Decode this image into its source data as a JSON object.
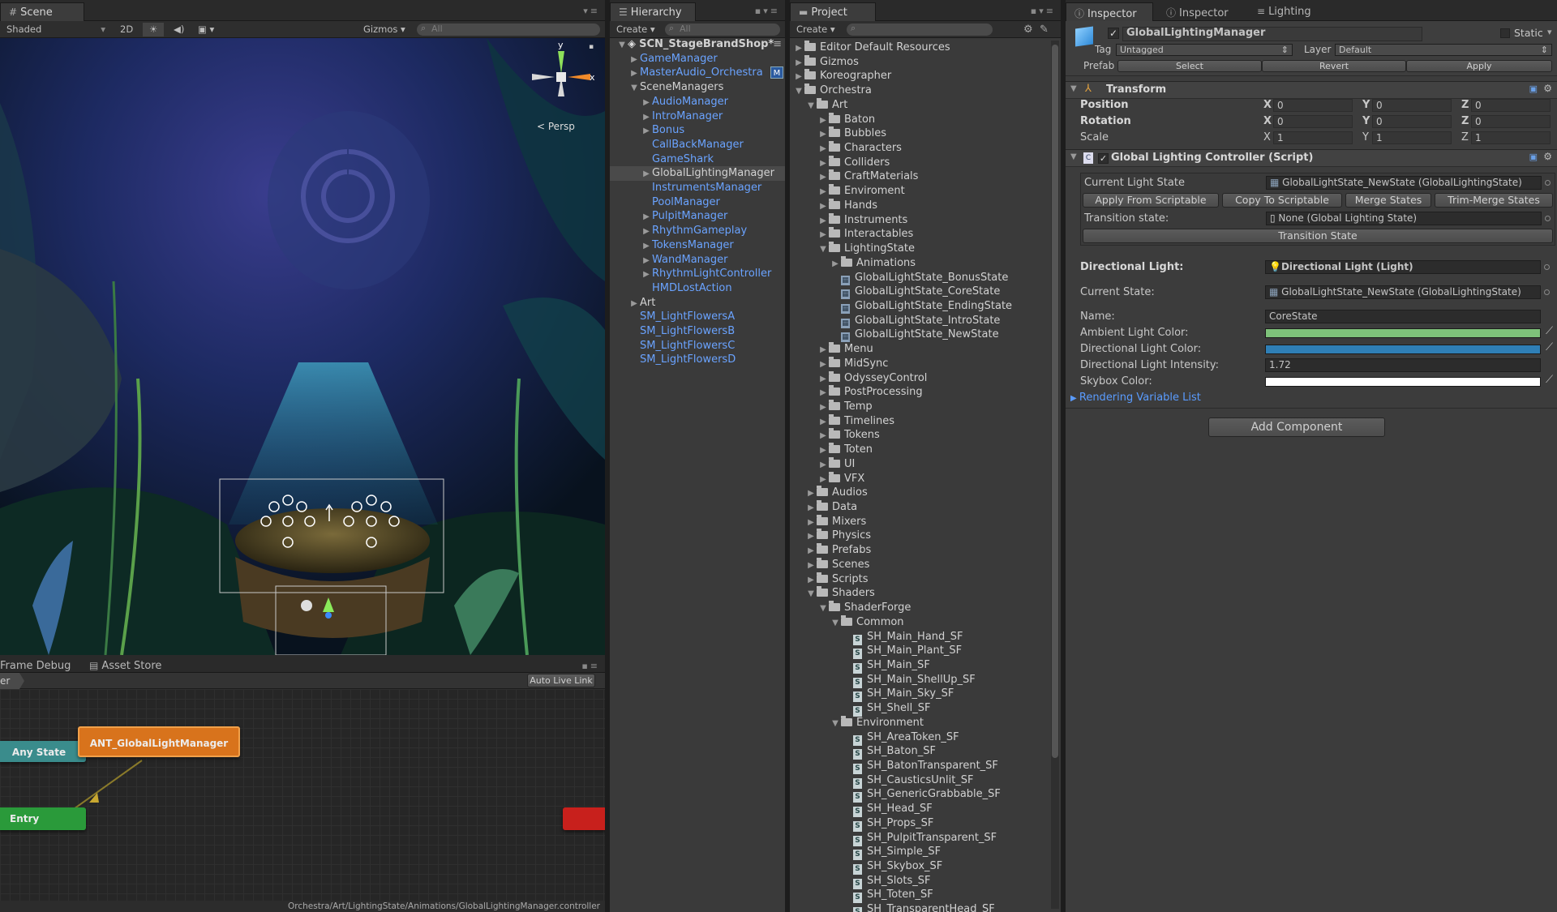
{
  "scene": {
    "tab": "Scene",
    "shading": "Shaded",
    "mode2d": "2D",
    "gizmos": "Gizmos",
    "search": "All",
    "persp": "Persp",
    "axis_x": "x",
    "axis_y": "y"
  },
  "animator": {
    "tab_frame": "Frame Debug",
    "tab_store": "Asset Store",
    "breadcrumb": "er",
    "auto_live": "Auto Live Link",
    "node_main": "ANT_GlobalLightManager",
    "node_any": "Any State",
    "node_entry": "Entry",
    "path": "Orchestra/Art/LightingState/Animations/GlobalLightingManager.controller"
  },
  "hierarchy": {
    "tab": "Hierarchy",
    "create": "Create",
    "search": "All",
    "items": [
      {
        "label": "SCN_StageBrandShop*",
        "depth": 0,
        "arrow": "▼",
        "style": "scene"
      },
      {
        "label": "GameManager",
        "depth": 1,
        "arrow": "▶",
        "style": "blue"
      },
      {
        "label": "MasterAudio_Orchestra",
        "depth": 1,
        "arrow": "▶",
        "style": "blue",
        "badge": "M"
      },
      {
        "label": "SceneManagers",
        "depth": 1,
        "arrow": "▼",
        "style": "wht"
      },
      {
        "label": "AudioManager",
        "depth": 2,
        "arrow": "▶",
        "style": "blue"
      },
      {
        "label": "IntroManager",
        "depth": 2,
        "arrow": "▶",
        "style": "blue"
      },
      {
        "label": "Bonus",
        "depth": 2,
        "arrow": "▶",
        "style": "blue"
      },
      {
        "label": "CallBackManager",
        "depth": 2,
        "arrow": "",
        "style": "blue"
      },
      {
        "label": "GameShark",
        "depth": 2,
        "arrow": "",
        "style": "blue"
      },
      {
        "label": "GlobalLightingManager",
        "depth": 2,
        "arrow": "▶",
        "style": "wht",
        "selected": true
      },
      {
        "label": "InstrumentsManager",
        "depth": 2,
        "arrow": "",
        "style": "blue"
      },
      {
        "label": "PoolManager",
        "depth": 2,
        "arrow": "",
        "style": "blue"
      },
      {
        "label": "PulpitManager",
        "depth": 2,
        "arrow": "▶",
        "style": "blue"
      },
      {
        "label": "RhythmGameplay",
        "depth": 2,
        "arrow": "▶",
        "style": "blue"
      },
      {
        "label": "TokensManager",
        "depth": 2,
        "arrow": "▶",
        "style": "blue"
      },
      {
        "label": "WandManager",
        "depth": 2,
        "arrow": "▶",
        "style": "blue"
      },
      {
        "label": "RhythmLightController",
        "depth": 2,
        "arrow": "▶",
        "style": "blue"
      },
      {
        "label": "HMDLostAction",
        "depth": 2,
        "arrow": "",
        "style": "blue"
      },
      {
        "label": "Art",
        "depth": 1,
        "arrow": "▶",
        "style": "wht"
      },
      {
        "label": "SM_LightFlowersA",
        "depth": 1,
        "arrow": "",
        "style": "blue"
      },
      {
        "label": "SM_LightFlowersB",
        "depth": 1,
        "arrow": "",
        "style": "blue"
      },
      {
        "label": "SM_LightFlowersC",
        "depth": 1,
        "arrow": "",
        "style": "blue"
      },
      {
        "label": "SM_LightFlowersD",
        "depth": 1,
        "arrow": "",
        "style": "blue"
      }
    ]
  },
  "project": {
    "tab": "Project",
    "create": "Create",
    "items": [
      {
        "label": "Editor Default Resources",
        "depth": 0,
        "arrow": "▶",
        "kind": "folder"
      },
      {
        "label": "Gizmos",
        "depth": 0,
        "arrow": "▶",
        "kind": "folder"
      },
      {
        "label": "Koreographer",
        "depth": 0,
        "arrow": "▶",
        "kind": "folder"
      },
      {
        "label": "Orchestra",
        "depth": 0,
        "arrow": "▼",
        "kind": "folder"
      },
      {
        "label": "Art",
        "depth": 1,
        "arrow": "▼",
        "kind": "folder"
      },
      {
        "label": "Baton",
        "depth": 2,
        "arrow": "▶",
        "kind": "folder"
      },
      {
        "label": "Bubbles",
        "depth": 2,
        "arrow": "▶",
        "kind": "folder"
      },
      {
        "label": "Characters",
        "depth": 2,
        "arrow": "▶",
        "kind": "folder"
      },
      {
        "label": "Colliders",
        "depth": 2,
        "arrow": "▶",
        "kind": "folder"
      },
      {
        "label": "CraftMaterials",
        "depth": 2,
        "arrow": "▶",
        "kind": "folder"
      },
      {
        "label": "Enviroment",
        "depth": 2,
        "arrow": "▶",
        "kind": "folder"
      },
      {
        "label": "Hands",
        "depth": 2,
        "arrow": "▶",
        "kind": "folder"
      },
      {
        "label": "Instruments",
        "depth": 2,
        "arrow": "▶",
        "kind": "folder"
      },
      {
        "label": "Interactables",
        "depth": 2,
        "arrow": "▶",
        "kind": "folder"
      },
      {
        "label": "LightingState",
        "depth": 2,
        "arrow": "▼",
        "kind": "folder"
      },
      {
        "label": "Animations",
        "depth": 3,
        "arrow": "▶",
        "kind": "folder"
      },
      {
        "label": "GlobalLightState_BonusState",
        "depth": 3,
        "arrow": "",
        "kind": "asset"
      },
      {
        "label": "GlobalLightState_CoreState",
        "depth": 3,
        "arrow": "",
        "kind": "asset"
      },
      {
        "label": "GlobalLightState_EndingState",
        "depth": 3,
        "arrow": "",
        "kind": "asset"
      },
      {
        "label": "GlobalLightState_IntroState",
        "depth": 3,
        "arrow": "",
        "kind": "asset"
      },
      {
        "label": "GlobalLightState_NewState",
        "depth": 3,
        "arrow": "",
        "kind": "asset"
      },
      {
        "label": "Menu",
        "depth": 2,
        "arrow": "▶",
        "kind": "folder"
      },
      {
        "label": "MidSync",
        "depth": 2,
        "arrow": "▶",
        "kind": "folder"
      },
      {
        "label": "OdysseyControl",
        "depth": 2,
        "arrow": "▶",
        "kind": "folder"
      },
      {
        "label": "PostProcessing",
        "depth": 2,
        "arrow": "▶",
        "kind": "folder"
      },
      {
        "label": "Temp",
        "depth": 2,
        "arrow": "▶",
        "kind": "folder"
      },
      {
        "label": "Timelines",
        "depth": 2,
        "arrow": "▶",
        "kind": "folder"
      },
      {
        "label": "Tokens",
        "depth": 2,
        "arrow": "▶",
        "kind": "folder"
      },
      {
        "label": "Toten",
        "depth": 2,
        "arrow": "▶",
        "kind": "folder"
      },
      {
        "label": "UI",
        "depth": 2,
        "arrow": "▶",
        "kind": "folder"
      },
      {
        "label": "VFX",
        "depth": 2,
        "arrow": "▶",
        "kind": "folder"
      },
      {
        "label": "Audios",
        "depth": 1,
        "arrow": "▶",
        "kind": "folder"
      },
      {
        "label": "Data",
        "depth": 1,
        "arrow": "▶",
        "kind": "folder"
      },
      {
        "label": "Mixers",
        "depth": 1,
        "arrow": "▶",
        "kind": "folder"
      },
      {
        "label": "Physics",
        "depth": 1,
        "arrow": "▶",
        "kind": "folder"
      },
      {
        "label": "Prefabs",
        "depth": 1,
        "arrow": "▶",
        "kind": "folder"
      },
      {
        "label": "Scenes",
        "depth": 1,
        "arrow": "▶",
        "kind": "folder"
      },
      {
        "label": "Scripts",
        "depth": 1,
        "arrow": "▶",
        "kind": "folder"
      },
      {
        "label": "Shaders",
        "depth": 1,
        "arrow": "▼",
        "kind": "folder"
      },
      {
        "label": "ShaderForge",
        "depth": 2,
        "arrow": "▼",
        "kind": "folder"
      },
      {
        "label": "Common",
        "depth": 3,
        "arrow": "▼",
        "kind": "folder"
      },
      {
        "label": "SH_Main_Hand_SF",
        "depth": 4,
        "arrow": "",
        "kind": "shader"
      },
      {
        "label": "SH_Main_Plant_SF",
        "depth": 4,
        "arrow": "",
        "kind": "shader"
      },
      {
        "label": "SH_Main_SF",
        "depth": 4,
        "arrow": "",
        "kind": "shader"
      },
      {
        "label": "SH_Main_ShellUp_SF",
        "depth": 4,
        "arrow": "",
        "kind": "shader"
      },
      {
        "label": "SH_Main_Sky_SF",
        "depth": 4,
        "arrow": "",
        "kind": "shader"
      },
      {
        "label": "SH_Shell_SF",
        "depth": 4,
        "arrow": "",
        "kind": "shader"
      },
      {
        "label": "Environment",
        "depth": 3,
        "arrow": "▼",
        "kind": "folder"
      },
      {
        "label": "SH_AreaToken_SF",
        "depth": 4,
        "arrow": "",
        "kind": "shader"
      },
      {
        "label": "SH_Baton_SF",
        "depth": 4,
        "arrow": "",
        "kind": "shader"
      },
      {
        "label": "SH_BatonTransparent_SF",
        "depth": 4,
        "arrow": "",
        "kind": "shader"
      },
      {
        "label": "SH_CausticsUnlit_SF",
        "depth": 4,
        "arrow": "",
        "kind": "shader"
      },
      {
        "label": "SH_GenericGrabbable_SF",
        "depth": 4,
        "arrow": "",
        "kind": "shader"
      },
      {
        "label": "SH_Head_SF",
        "depth": 4,
        "arrow": "",
        "kind": "shader"
      },
      {
        "label": "SH_Props_SF",
        "depth": 4,
        "arrow": "",
        "kind": "shader"
      },
      {
        "label": "SH_PulpitTransparent_SF",
        "depth": 4,
        "arrow": "",
        "kind": "shader"
      },
      {
        "label": "SH_Simple_SF",
        "depth": 4,
        "arrow": "",
        "kind": "shader"
      },
      {
        "label": "SH_Skybox_SF",
        "depth": 4,
        "arrow": "",
        "kind": "shader"
      },
      {
        "label": "SH_Slots_SF",
        "depth": 4,
        "arrow": "",
        "kind": "shader"
      },
      {
        "label": "SH_Toten_SF",
        "depth": 4,
        "arrow": "",
        "kind": "shader"
      },
      {
        "label": "SH_TransparentHead_SF",
        "depth": 4,
        "arrow": "",
        "kind": "shader"
      }
    ]
  },
  "inspector": {
    "tabs": [
      "Inspector",
      "Inspector",
      "Lighting"
    ],
    "object_name": "GlobalLightingManager",
    "static_label": "Static",
    "tag_label": "Tag",
    "tag_value": "Untagged",
    "layer_label": "Layer",
    "layer_value": "Default",
    "prefab_label": "Prefab",
    "prefab_select": "Select",
    "prefab_revert": "Revert",
    "prefab_apply": "Apply",
    "transform_title": "Transform",
    "position_label": "Position",
    "rotation_label": "Rotation",
    "scale_label": "Scale",
    "axis_x": "X",
    "axis_y": "Y",
    "axis_z": "Z",
    "position": [
      "0",
      "0",
      "0"
    ],
    "rotation": [
      "0",
      "0",
      "0"
    ],
    "scale": [
      "1",
      "1",
      "1"
    ],
    "script_title": "Global Lighting Controller (Script)",
    "current_light_state_label": "Current Light State",
    "current_light_state_value": "GlobalLightState_NewState (GlobalLightingState)",
    "btn_apply": "Apply From Scriptable",
    "btn_copy": "Copy To Scriptable",
    "btn_merge": "Merge States",
    "btn_trim": "Trim-Merge States",
    "transition_state_label": "Transition state:",
    "transition_state_value": "None (Global Lighting State)",
    "btn_transition": "Transition State",
    "directional_light_label": "Directional Light:",
    "directional_light_value": "Directional Light (Light)",
    "current_state_label": "Current State:",
    "current_state_value": "GlobalLightState_NewState (GlobalLightingState)",
    "name_label": "Name:",
    "name_value": "CoreState",
    "ambient_label": "Ambient Light Color:",
    "ambient_color": "#7ec27a",
    "dir_color_label": "Directional Light Color:",
    "dir_color": "#2f7fb6",
    "intensity_label": "Directional Light Intensity:",
    "intensity_value": "1.72",
    "skybox_label": "Skybox Color:",
    "skybox_color": "#ffffff",
    "rendering_list": "Rendering Variable List",
    "add_component": "Add Component"
  }
}
